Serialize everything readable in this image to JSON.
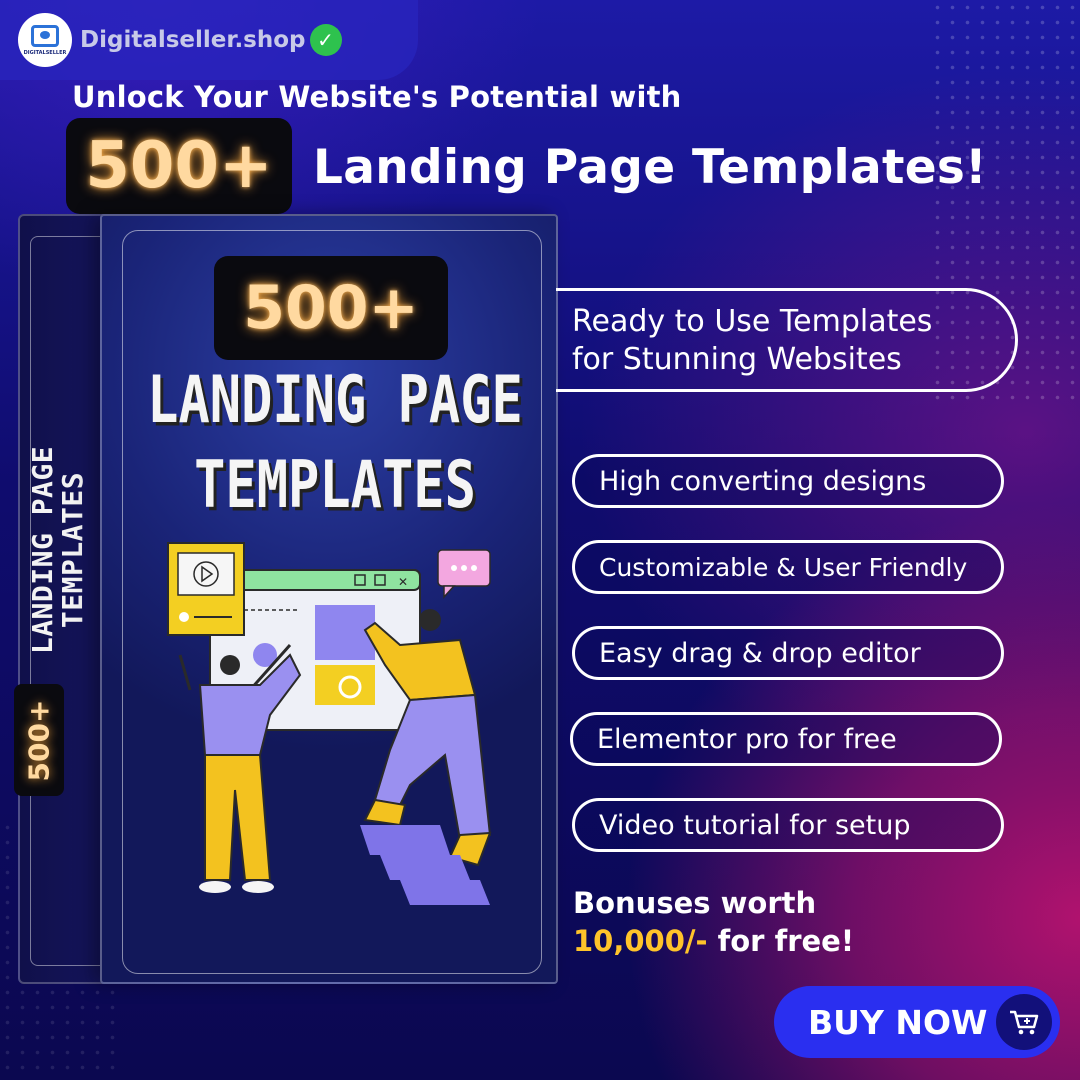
{
  "brand": {
    "logo_text": "DIGITALSELLER",
    "name": "Digitalseller.shop",
    "verified_icon": "check-circle-icon"
  },
  "headline": {
    "top": "Unlock Your Website's Potential with",
    "badge": "500+",
    "main": "Landing Page Templates!"
  },
  "product_box": {
    "badge": "500+",
    "title_line1": "LANDING PAGE",
    "title_line2": "TEMPLATES",
    "side_title_line1": "LANDING PAGE",
    "side_title_line2": "TEMPLATES",
    "side_badge": "500+"
  },
  "features": {
    "hero_line1": "Ready to Use Templates",
    "hero_line2": "for Stunning Websites",
    "items": [
      "High converting designs",
      "Customizable & User Friendly",
      "Easy drag & drop editor",
      "Elementor pro for free",
      "Video tutorial for setup"
    ]
  },
  "bonus": {
    "line1": "Bonuses worth",
    "amount": "10,000/-",
    "suffix": " for free!"
  },
  "cta": {
    "label": "BUY NOW",
    "icon": "cart-icon"
  },
  "colors": {
    "accent_yellow": "#ffc42a",
    "button_blue": "#2a2ff0",
    "badge_glow": "#ffd9a0",
    "background_top": "#1d1aa6",
    "background_magenta": "#b0126e"
  }
}
